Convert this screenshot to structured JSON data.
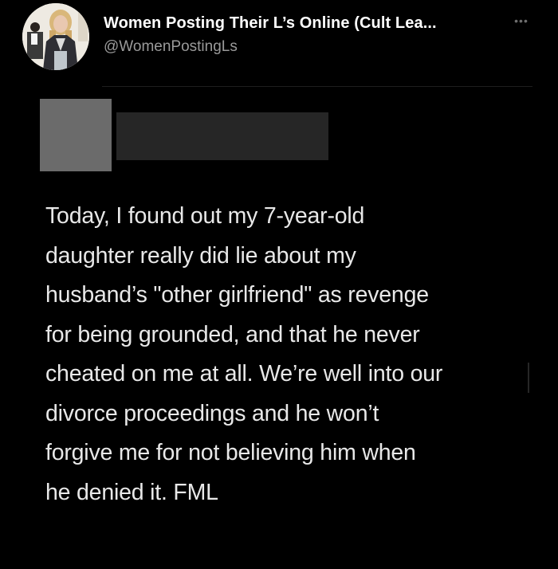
{
  "account": {
    "display_name": "Women Posting Their L’s Online (Cult Lea...",
    "handle": "@WomenPostingLs",
    "more_icon": "more-horizontal-icon"
  },
  "post": {
    "text": "Today, I found out my 7-year-old\ndaughter really did lie about my\nhusband’s \"other girlfriend\" as revenge\nfor being grounded, and that he never\ncheated on me at all. We’re well into our\ndivorce proceedings and he won’t\nforgive me for not believing him when\nhe denied it. FML"
  },
  "colors": {
    "background": "#000000",
    "text": "#e8e8e8",
    "handle": "#9a9a9a",
    "redaction_light": "#6b6b6b",
    "redaction_dark": "#262626"
  }
}
